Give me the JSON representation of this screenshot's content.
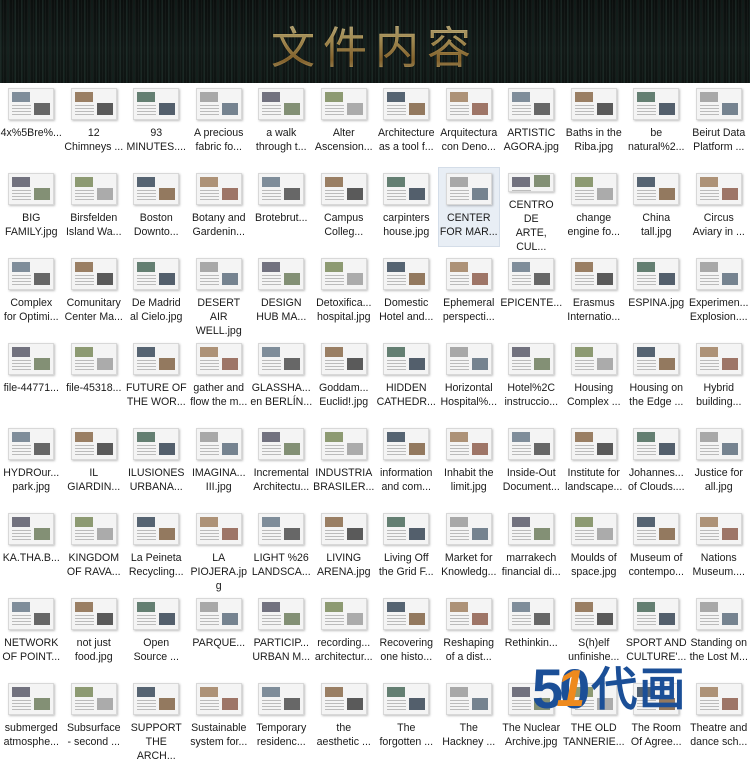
{
  "header": {
    "title": "文件内容"
  },
  "files": [
    {
      "label": "4x%5Bre%..."
    },
    {
      "label": "12\nChimneys ..."
    },
    {
      "label": "93\nMINUTES...."
    },
    {
      "label": "A precious\nfabric fo..."
    },
    {
      "label": "a walk\nthrough t..."
    },
    {
      "label": "Alter\nAscension..."
    },
    {
      "label": "Architecture\nas a tool f..."
    },
    {
      "label": "Arquitectura\ncon Deno..."
    },
    {
      "label": "ARTISTIC\nAGORA.jpg"
    },
    {
      "label": "Baths in the\nRiba.jpg"
    },
    {
      "label": "be\nnatural%2..."
    },
    {
      "label": "Beirut Data\nPlatform ..."
    },
    {
      "label": "BIG\nFAMILY.jpg"
    },
    {
      "label": "Birsfelden\nIsland Wa..."
    },
    {
      "label": "Boston\nDownto..."
    },
    {
      "label": "Botany and\nGardenin..."
    },
    {
      "label": "Brotebrut..."
    },
    {
      "label": "Campus\nColleg..."
    },
    {
      "label": "carpinters\nhouse.jpg"
    },
    {
      "label": "CENTER\nFOR MAR...",
      "selected": true
    },
    {
      "label": "CENTRO DE\nARTE, CUL..."
    },
    {
      "label": "change\nengine fo..."
    },
    {
      "label": "China\ntall.jpg"
    },
    {
      "label": "Circus\nAviary in ..."
    },
    {
      "label": "Complex\nfor Optimi..."
    },
    {
      "label": "Comunitary\nCenter Ma..."
    },
    {
      "label": "De Madrid\nal Cielo.jpg"
    },
    {
      "label": "DESERT AIR\nWELL.jpg"
    },
    {
      "label": "DESIGN\nHUB MA..."
    },
    {
      "label": "Detoxifica...\nhospital.jpg"
    },
    {
      "label": "Domestic\nHotel and..."
    },
    {
      "label": "Ephemeral\nperspecti..."
    },
    {
      "label": "EPICENTE..."
    },
    {
      "label": "Erasmus\nInternatio..."
    },
    {
      "label": "ESPINA.jpg"
    },
    {
      "label": "Experimen...\nExplosion...."
    },
    {
      "label": "file-44771..."
    },
    {
      "label": "file-45318..."
    },
    {
      "label": "FUTURE OF\nTHE WOR..."
    },
    {
      "label": "gather and\nflow the m..."
    },
    {
      "label": "GLASSHA...\nen BERLÍN..."
    },
    {
      "label": "Goddam...\nEuclid!.jpg"
    },
    {
      "label": "HIDDEN\nCATHEDR..."
    },
    {
      "label": "Horizontal\nHospital%..."
    },
    {
      "label": "Hotel%2C\ninstruccio..."
    },
    {
      "label": "Housing\nComplex ..."
    },
    {
      "label": "Housing on\nthe Edge ..."
    },
    {
      "label": "Hybrid\nbuilding..."
    },
    {
      "label": "HYDROur...\npark.jpg"
    },
    {
      "label": "IL\nGIARDIN..."
    },
    {
      "label": "ILUSIONES\nURBANA..."
    },
    {
      "label": "IMAGINA...\nIII.jpg"
    },
    {
      "label": "Incremental\nArchitectu..."
    },
    {
      "label": "INDUSTRIA\nBRASILER..."
    },
    {
      "label": "information\nand com..."
    },
    {
      "label": "Inhabit the\nlimit.jpg"
    },
    {
      "label": "Inside-Out\nDocument..."
    },
    {
      "label": "Institute for\nlandscape..."
    },
    {
      "label": "Johannes...\nof Clouds...."
    },
    {
      "label": "Justice for\nall.jpg"
    },
    {
      "label": "KA.THA.B..."
    },
    {
      "label": "KINGDOM\nOF RAVA..."
    },
    {
      "label": "La Peineta\nRecycling..."
    },
    {
      "label": "LA\nPIOJERA.jpg"
    },
    {
      "label": "LIGHT %26\nLANDSCA..."
    },
    {
      "label": "LIVING\nARENA.jpg"
    },
    {
      "label": "Living Off\nthe Grid F..."
    },
    {
      "label": "Market for\nKnowledg..."
    },
    {
      "label": "marrakech\nfinancial di..."
    },
    {
      "label": "Moulds of\nspace.jpg"
    },
    {
      "label": "Museum of\ncontempo..."
    },
    {
      "label": "Nations\nMuseum...."
    },
    {
      "label": "NETWORK\nOF POINT..."
    },
    {
      "label": "not just\nfood.jpg"
    },
    {
      "label": "Open\nSource ..."
    },
    {
      "label": "PARQUE..."
    },
    {
      "label": "PARTICIP...\nURBAN M..."
    },
    {
      "label": "recording...\narchitectur..."
    },
    {
      "label": "Recovering\none histo..."
    },
    {
      "label": "Reshaping\nof a dist..."
    },
    {
      "label": "Rethinkin..."
    },
    {
      "label": "S(h)elf\nunfinishe..."
    },
    {
      "label": "SPORT AND\nCULTURE'..."
    },
    {
      "label": "Standing on\nthe Lost M..."
    },
    {
      "label": "submerged\natmosphe..."
    },
    {
      "label": "Subsurface\n- second ..."
    },
    {
      "label": "SUPPORT\nTHE ARCH..."
    },
    {
      "label": "Sustainable\nsystem for..."
    },
    {
      "label": "Temporary\nresidenc..."
    },
    {
      "label": "the\naesthetic ..."
    },
    {
      "label": "The\nforgotten ..."
    },
    {
      "label": "The\nHackney ..."
    },
    {
      "label": "The Nuclear\nArchive.jpg"
    },
    {
      "label": "THE OLD\nTANNERIE..."
    },
    {
      "label": "The Room\nOf Agree..."
    },
    {
      "label": "Theatre and\ndance sch..."
    }
  ],
  "watermark": {
    "digits_a": "5",
    "digits_b": "0",
    "digit_accent": "1",
    "text": "代画"
  },
  "colors": {
    "watermark_blue": "#1b4f97",
    "watermark_orange": "#ee8a1e",
    "title_gold": "#e8c97a",
    "selected_bg": "#e8eef5"
  }
}
